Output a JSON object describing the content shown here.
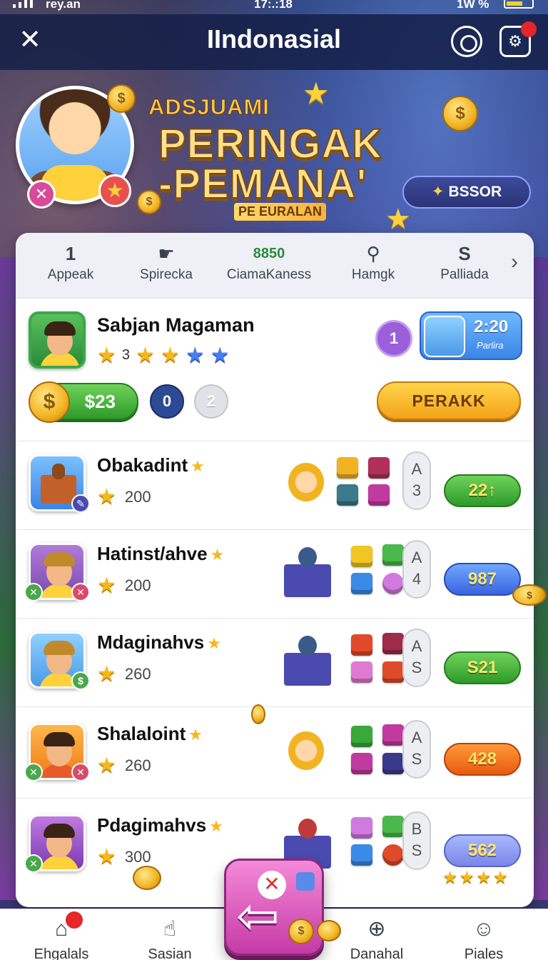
{
  "status_bar": {
    "carrier": "rey.an",
    "time": "17:.:18",
    "network": "1W %"
  },
  "top_bar": {
    "title": "IIndonasial"
  },
  "banner": {
    "subtitle": "ADSJUAMI",
    "headline_1": "PERINGAK",
    "headline_2": "-PEMANA'",
    "caption": "PE EURALAN",
    "action_label": "BSSOR"
  },
  "tabs": [
    {
      "label": "Appeak",
      "icon": "1",
      "icon_name": "chart-icon"
    },
    {
      "label": "Spirecka",
      "icon": "☛",
      "icon_name": "leaf-icon"
    },
    {
      "label": "CiamaKaness",
      "icon": "8850",
      "icon_name": "score-icon"
    },
    {
      "label": "Hamgk",
      "icon": "⚲",
      "icon_name": "search-icon"
    },
    {
      "label": "Palliada",
      "icon": "S",
      "icon_name": "s-icon"
    }
  ],
  "featured": {
    "name": "Sabjan Magaman",
    "star_count": "3",
    "level": "1",
    "timer": "2:20",
    "timer_label": "Parlira",
    "money": "$23",
    "chip_a": "0",
    "chip_b": "2",
    "claim_label": "PERAKK"
  },
  "rows": [
    {
      "name": "Obakadint",
      "score": "200",
      "rank_top": "A",
      "rank_bottom": "3",
      "reward": "22↑",
      "reward_color": "green"
    },
    {
      "name": "Hatinst/ahve",
      "score": "200",
      "rank_top": "A",
      "rank_bottom": "4",
      "reward": "987",
      "reward_color": "blue"
    },
    {
      "name": "Mdaginahvs",
      "score": "260",
      "rank_top": "A",
      "rank_bottom": "S",
      "reward": "S21",
      "reward_color": "green"
    },
    {
      "name": "Shalaloint",
      "score": "260",
      "rank_top": "A",
      "rank_bottom": "S",
      "reward": "428",
      "reward_color": "orange"
    },
    {
      "name": "Pdagimahvs",
      "score": "300",
      "rank_top": "B",
      "rank_bottom": "S",
      "reward": "562",
      "reward_color": "purple"
    }
  ],
  "bottom_nav": [
    {
      "label": "Ehgalals",
      "icon_name": "home-icon"
    },
    {
      "label": "Sasian",
      "icon_name": "hand-icon"
    },
    {
      "label": "Danahal",
      "icon_name": "trend-icon"
    },
    {
      "label": "Piales",
      "icon_name": "profile-icon"
    }
  ],
  "colors": {
    "accent_gold": "#f5b81c",
    "claim_orange": "#f3a21a",
    "money_green": "#2e9a2a",
    "fab_pink": "#c43aa6"
  }
}
